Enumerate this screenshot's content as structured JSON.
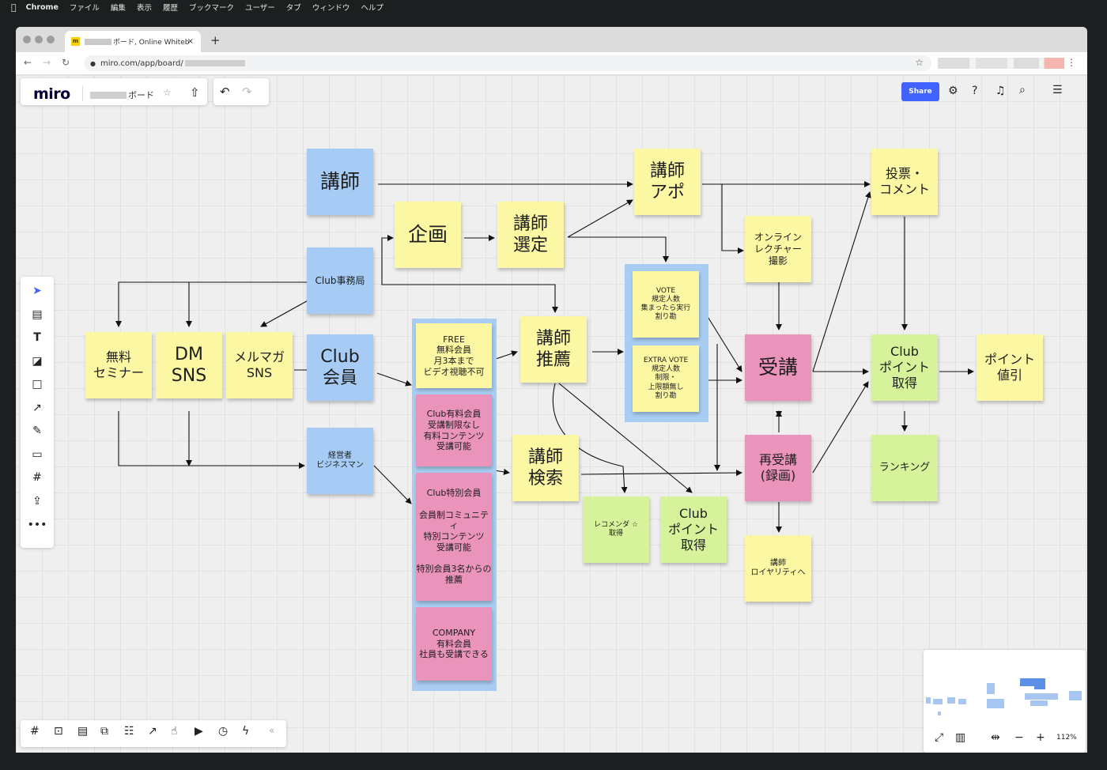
{
  "os_menu": {
    "apple": "",
    "items": [
      "Chrome",
      "ファイル",
      "編集",
      "表示",
      "履歴",
      "ブックマーク",
      "ユーザー",
      "タブ",
      "ウィンドウ",
      "ヘルプ"
    ]
  },
  "browser": {
    "tab_title": "ボード, Online Whiteb",
    "tab_favicon": "m",
    "tab_close": "×",
    "new_tab": "+",
    "url": "miro.com/app/board/",
    "nav": {
      "back": "←",
      "forward": "→",
      "reload": "↻"
    },
    "bookmark_star": "☆",
    "menu": "⋮"
  },
  "miro": {
    "logo": "miro",
    "board_name": "ボード",
    "star": "☆",
    "share_label": "Share",
    "zoom": "112%"
  },
  "notes": {
    "koshi": "講師",
    "kikaku": "企画",
    "koshi_sentei": "講師\n選定",
    "koshi_apo": "講師\nアポ",
    "tohyo": "投票・\nコメント",
    "online": "オンライン\nレクチャー\n撮影",
    "club_jimukyoku": "Club事務局",
    "muryo": "無料\nセミナー",
    "dm": "DM\nSNS",
    "merumaga": "メルマガ\nSNS",
    "club_kaiin": "Club\n会員",
    "keieisha": "経営者\nビジネスマン",
    "free": "FREE\n無料会員\n月3本まで\nビデオ視聴不可",
    "yuryo": "Club有料会員\n受講制限なし\n有料コンテンツ\n受講可能",
    "tokubetsu": "Club特別会員\n\n会員制コミュニティ\n特別コンテンツ\n受講可能\n\n特別会員3名からの推薦",
    "company": "COMPANY\n有料会員\n社員も受講できる",
    "koshi_suisen": "講師\n推薦",
    "vote": "VOTE\n規定人数\n集まったら実行\n割り勘",
    "extra_vote": "EXTRA VOTE\n規定人数\n制限・\n上限額無し\n割り勘",
    "jukou": "受講",
    "club_point": "Club\nポイント\n取得",
    "point_nebiki": "ポイント\n値引",
    "koshi_kensaku": "講師\n検索",
    "saijukou": "再受講\n(録画)",
    "ranking": "ランキング",
    "recommend": "レコメンダ ☆\n取得",
    "club_point2": "Club\nポイント\n取得",
    "royalty": "講師\nロイヤリティへ"
  },
  "colors": {
    "blue_note": "#a6ccf5",
    "yellow_note": "#fcf7a3",
    "pink_note": "#ea94bb",
    "green_note": "#d6f29a",
    "share_blue": "#4262ff",
    "cursor_blue": "#4262ff"
  },
  "icons": {
    "left_toolbar": [
      "select-cursor-icon",
      "templates-icon",
      "text-icon",
      "sticky-note-icon",
      "shape-icon",
      "connection-line-icon",
      "pen-icon",
      "comment-icon",
      "frame-icon",
      "upload-icon",
      "more-icon"
    ],
    "bottom_toolbar": [
      "frames-icon",
      "presentation-icon",
      "comments-icon",
      "screen-share-icon",
      "card-icon",
      "share-screen-icon",
      "reaction-icon",
      "video-icon",
      "timer-icon",
      "power-up-icon",
      "collapse-icon"
    ],
    "top_right": [
      "settings-icon",
      "help-icon",
      "notifications-icon",
      "search-icon",
      "board-notes-icon"
    ],
    "minimap": [
      "fullscreen-icon",
      "map-icon",
      "fit-icon",
      "zoom-out-icon",
      "zoom-in-icon"
    ]
  }
}
